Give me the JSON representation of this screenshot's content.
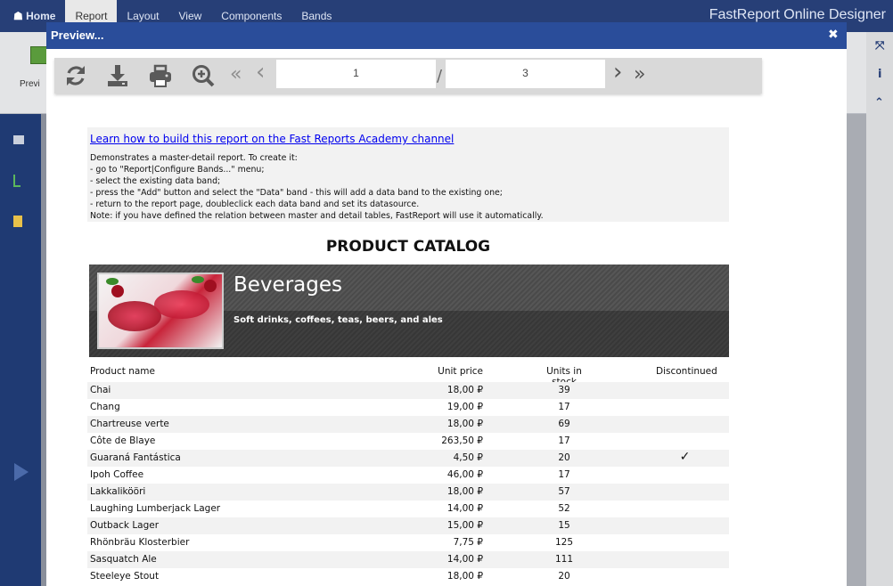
{
  "designer": {
    "home_label": "Home",
    "menu": [
      "Report",
      "Layout",
      "View",
      "Components",
      "Bands"
    ],
    "brand": "FastReport Online Designer",
    "preview_button_label": "Previ"
  },
  "modal": {
    "title": "Preview...",
    "close_glyph": "✖"
  },
  "toolbar": {
    "current_page": "1",
    "separator": "/",
    "total_pages": "3",
    "first_glyph": "«",
    "prev_glyph": "‹",
    "next_glyph": "›",
    "last_glyph": "»"
  },
  "report": {
    "academy_link": "Learn how to build this report on the Fast Reports Academy channel",
    "notes": [
      "Demonstrates a master-detail report. To create it:",
      "- go to \"Report|Configure Bands...\" menu;",
      "- select the existing data band;",
      "- press the \"Add\" button and select the \"Data\" band - this will add a data band to the existing one;",
      "- return to the report page, doubleclick each data band and set its datasource.",
      "Note: if you have defined the relation between master and detail tables, FastReport will use it automatically."
    ],
    "title": "PRODUCT CATALOG",
    "category": {
      "name": "Beverages",
      "description": "Soft drinks, coffees, teas, beers, and ales"
    },
    "columns": {
      "name": "Product name",
      "price": "Unit price",
      "stock": "Units in stock",
      "discontinued": "Discontinued"
    },
    "rows": [
      {
        "name": "Chai",
        "price": "18,00 ₽",
        "stock": "39",
        "disc": ""
      },
      {
        "name": "Chang",
        "price": "19,00 ₽",
        "stock": "17",
        "disc": ""
      },
      {
        "name": "Chartreuse verte",
        "price": "18,00 ₽",
        "stock": "69",
        "disc": ""
      },
      {
        "name": "Côte de Blaye",
        "price": "263,50 ₽",
        "stock": "17",
        "disc": ""
      },
      {
        "name": "Guaraná Fantástica",
        "price": "4,50 ₽",
        "stock": "20",
        "disc": "✓"
      },
      {
        "name": "Ipoh Coffee",
        "price": "46,00 ₽",
        "stock": "17",
        "disc": ""
      },
      {
        "name": "Lakkalikööri",
        "price": "18,00 ₽",
        "stock": "57",
        "disc": ""
      },
      {
        "name": "Laughing Lumberjack Lager",
        "price": "14,00 ₽",
        "stock": "52",
        "disc": ""
      },
      {
        "name": "Outback Lager",
        "price": "15,00 ₽",
        "stock": "15",
        "disc": ""
      },
      {
        "name": "Rhönbräu Klosterbier",
        "price": "7,75 ₽",
        "stock": "125",
        "disc": ""
      },
      {
        "name": "Sasquatch Ale",
        "price": "14,00 ₽",
        "stock": "111",
        "disc": ""
      },
      {
        "name": "Steeleye Stout",
        "price": "18,00 ₽",
        "stock": "20",
        "disc": ""
      }
    ]
  },
  "colors": {
    "topbar": "#273f77",
    "modal_header": "#2a4d9a",
    "banner": "#4a4a4a"
  }
}
